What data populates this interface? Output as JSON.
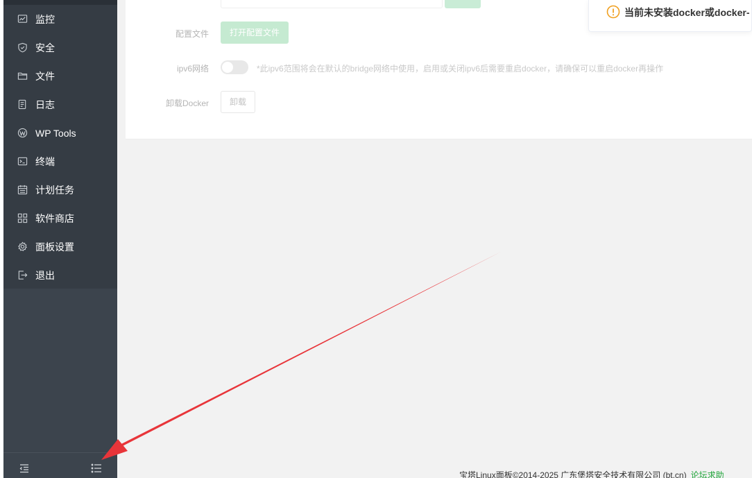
{
  "sidebar": {
    "items": [
      {
        "label": "监控",
        "icon": "monitor-icon"
      },
      {
        "label": "安全",
        "icon": "shield-icon"
      },
      {
        "label": "文件",
        "icon": "folder-icon"
      },
      {
        "label": "日志",
        "icon": "log-icon"
      },
      {
        "label": "WP Tools",
        "icon": "wordpress-icon"
      },
      {
        "label": "终端",
        "icon": "terminal-icon"
      },
      {
        "label": "计划任务",
        "icon": "calendar-icon"
      },
      {
        "label": "软件商店",
        "icon": "grid-icon"
      },
      {
        "label": "面板设置",
        "icon": "gear-icon"
      },
      {
        "label": "退出",
        "icon": "logout-icon"
      }
    ],
    "bottom": {
      "collapse_icon": "collapse-menu-icon",
      "list_icon": "list-icon"
    }
  },
  "settings": {
    "config_file_label": "配置文件",
    "config_file_button": "打开配置文件",
    "ipv6_label": "ipv6网络",
    "ipv6_enabled": false,
    "ipv6_hint": "*此ipv6范围将会在默认的bridge网络中使用，启用或关闭ipv6后需要重启docker，请确保可以重启docker再操作",
    "uninstall_label": "卸载Docker",
    "uninstall_button": "卸载"
  },
  "notice": {
    "text": "当前未安装docker或docker-",
    "icon": "warning-icon",
    "color": "#f0a020"
  },
  "footer": {
    "copyright": "宝塔Linux面板©2014-2025 广东堡塔安全技术有限公司 (bt.cn)",
    "link": "论坛求助"
  },
  "colors": {
    "sidebar_bg": "#3c444d",
    "menu_bg": "#353c44",
    "accent_green": "#20a53a",
    "annotation_arrow": "#e8353a"
  }
}
